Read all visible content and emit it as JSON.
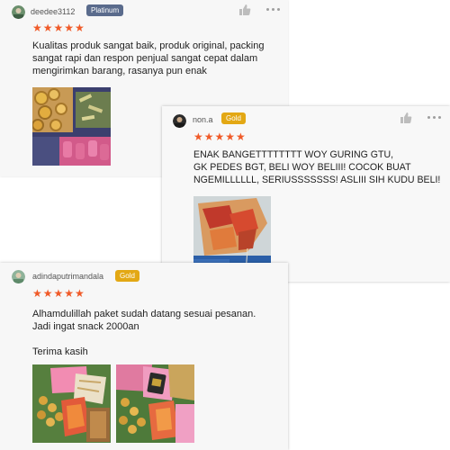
{
  "reviews": [
    {
      "username": "deedee3112",
      "badge": "Platinum",
      "stars": "★★★★★",
      "text_lines": [
        "Kualitas produk sangat baik, produk original, packing",
        "sangat rapi dan respon penjual sangat cepat dalam",
        "mengirimkan barang, rasanya pun enak"
      ],
      "photos": [
        "snack-photo"
      ]
    },
    {
      "username": "non.a",
      "badge": "Gold",
      "stars": "★★★★★",
      "text_lines": [
        "ENAK BANGETTTTTTTT WOY GURING GTU,",
        "GK PEDES BGT, BELI WOY BELIII! COCOK BUAT",
        "NGEMILLLLLL, SERIUSSSSSSS! ASLIII SIH KUDU BELI!"
      ],
      "photos": [
        "snack-photo"
      ]
    },
    {
      "username": "adindaputrimandala",
      "badge": "Gold",
      "stars": "★★★★★",
      "text_lines": [
        "Alhamdulillah paket sudah datang sesuai pesanan.",
        "Jadi ingat snack 2000an",
        "",
        "Terima kasih"
      ],
      "photos": [
        "snack-photo",
        "snack-photo"
      ]
    }
  ],
  "icons": {
    "like": "thumbs-up-icon",
    "more": "more-options-icon",
    "star": "star-icon"
  },
  "colors": {
    "star": "#f05a28",
    "platinum_badge": "#5a6b8c",
    "gold_badge": "#e3a814",
    "card_bg": "#f7f7f7"
  }
}
